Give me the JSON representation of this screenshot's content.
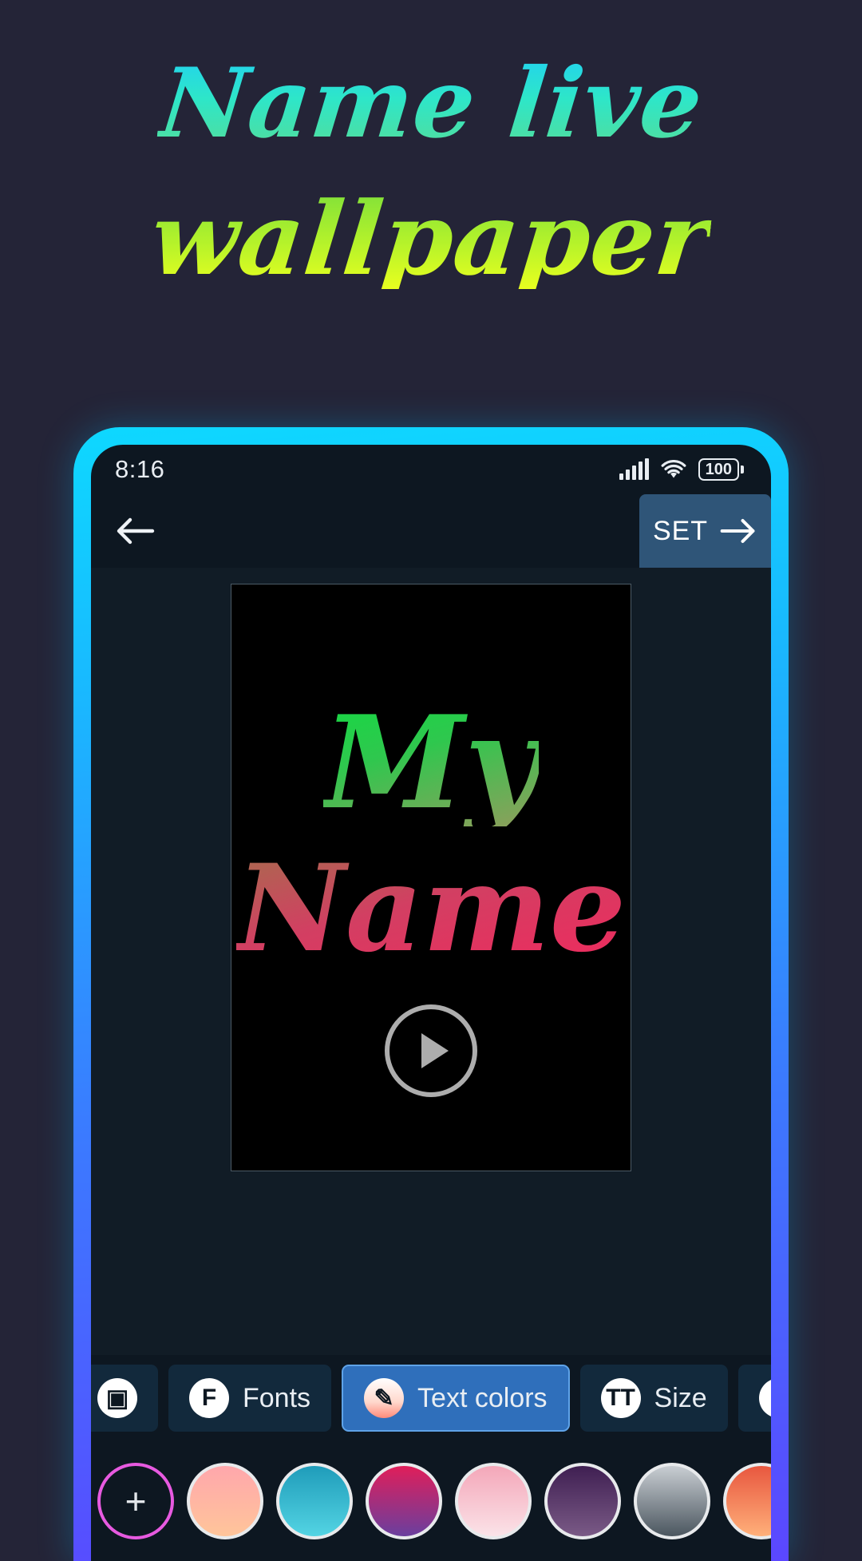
{
  "promo": {
    "line1": "Name live",
    "line2": "wallpaper",
    "line1_gradient": [
      "#22d3ee",
      "#54dd9a"
    ],
    "line2_gradient": [
      "#7ee03a",
      "#e8ff1f"
    ],
    "background": "#242437"
  },
  "phone": {
    "bezel_gradient": [
      "#0ed8ff",
      "#5b47ff"
    ]
  },
  "status_bar": {
    "time": "8:16",
    "signal_icon": "cellular-signal-icon",
    "wifi_icon": "wifi-icon",
    "battery_icon": "battery-icon",
    "battery_level": "100"
  },
  "app_bar": {
    "back_icon": "arrow-left-icon",
    "set_label": "SET",
    "set_arrow_icon": "arrow-right-icon",
    "set_button_color": "#2f5578"
  },
  "preview": {
    "word1": "My",
    "word2": "Name",
    "word1_gradient": [
      "#16d943",
      "#8f9e5c"
    ],
    "word2_gradient": [
      "#a86b4e",
      "#ef2a5e"
    ],
    "canvas_background": "#000000",
    "play_icon": "play-icon"
  },
  "toolbar": {
    "items": [
      {
        "label": "",
        "icon": "crop-icon",
        "icon_glyph": "▣",
        "active": false,
        "partial": true
      },
      {
        "label": "Fonts",
        "icon": "font-icon",
        "icon_glyph": "F",
        "active": false,
        "partial": false
      },
      {
        "label": "Text colors",
        "icon": "eyedropper-icon",
        "icon_glyph": "✎",
        "active": true,
        "partial": false
      },
      {
        "label": "Size",
        "icon": "text-size-icon",
        "icon_glyph": "TT",
        "active": false,
        "partial": false
      },
      {
        "label": "",
        "icon": "speed-gauge-icon",
        "icon_glyph": "◔",
        "active": false,
        "partial": true
      }
    ],
    "active_color": "#2f6fbb"
  },
  "color_swatches": {
    "add_label": "+",
    "add_ring_color": "#e75ae0",
    "items": [
      {
        "name": "swatch-add",
        "gradient": null
      },
      {
        "name": "swatch-peach",
        "gradient": [
          "#ffa7ac",
          "#ffc59a"
        ]
      },
      {
        "name": "swatch-teal",
        "gradient": [
          "#1f9cba",
          "#53d4e3"
        ]
      },
      {
        "name": "swatch-crimson-purple",
        "gradient": [
          "#e01e5a",
          "#6a3f9e"
        ]
      },
      {
        "name": "swatch-light-pink",
        "gradient": [
          "#f4a7b9",
          "#fbe3e8"
        ]
      },
      {
        "name": "swatch-deep-purple",
        "gradient": [
          "#3f1f52",
          "#7a5a86"
        ]
      },
      {
        "name": "swatch-silver",
        "gradient": [
          "#c9ced3",
          "#4b565f"
        ]
      },
      {
        "name": "swatch-coral",
        "gradient": [
          "#e8573f",
          "#ffb07a"
        ]
      }
    ]
  }
}
